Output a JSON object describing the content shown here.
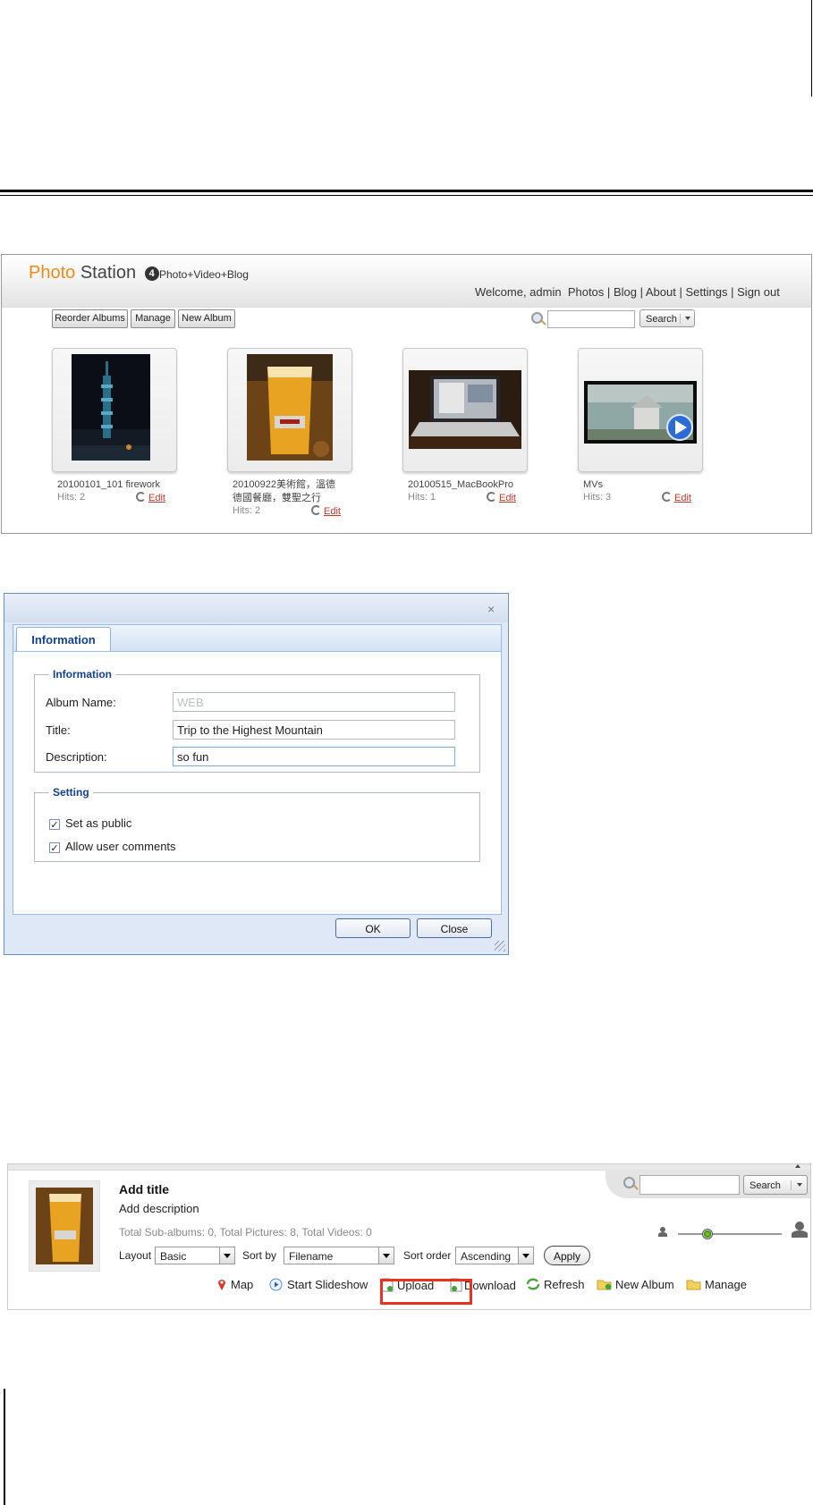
{
  "photo_station": {
    "logo_part1": "Photo",
    "logo_part2": "Station",
    "logo_badge": "4",
    "tagline": "Photo+Video+Blog",
    "welcome": "Welcome, admin",
    "nav": [
      "Photos",
      "Blog",
      "About",
      "Settings",
      "Sign out"
    ],
    "separator": "|",
    "buttons": {
      "reorder": "Reorder Albums",
      "manage": "Manage",
      "new_album": "New Album"
    },
    "search": {
      "placeholder": "",
      "button": "Search"
    },
    "edit_label": "Edit",
    "albums": [
      {
        "name": "20100101_101 firework",
        "hits": "Hits: 2"
      },
      {
        "name_line1": "20100922美術館，溫德",
        "name_line2": "德國餐廳，雙聖之行",
        "hits": "Hits: 2"
      },
      {
        "name": "20100515_MacBookPro",
        "hits": "Hits: 1"
      },
      {
        "name": "MVs",
        "hits": "Hits: 3"
      }
    ]
  },
  "dialog": {
    "tab": "Information",
    "close_icon": "×",
    "info_legend": "Information",
    "album_name_label": "Album Name:",
    "album_name_value": "WEB",
    "title_label": "Title:",
    "title_value": "Trip to the Highest Mountain",
    "description_label": "Description:",
    "description_value": "so fun",
    "setting_legend": "Setting",
    "set_public": "Set as public",
    "allow_comments": "Allow user comments",
    "checkmark": "✓",
    "ok": "OK",
    "close": "Close"
  },
  "album_toolbar": {
    "title": "Add title",
    "description": "Add description",
    "stats": "Total Sub-albums: 0, Total Pictures: 8, Total Videos: 0",
    "search_button": "Search",
    "layout_label": "Layout",
    "layout_value": "Basic",
    "sort_by_label": "Sort by",
    "sort_by_value": "Filename",
    "sort_order_label": "Sort order",
    "sort_order_value": "Ascending",
    "apply": "Apply",
    "actions": {
      "map": "Map",
      "slideshow": "Start Slideshow",
      "upload": "Upload",
      "download": "Download",
      "refresh": "Refresh",
      "new_album": "New Album",
      "manage": "Manage"
    },
    "highlight_color": "#ea3223"
  }
}
